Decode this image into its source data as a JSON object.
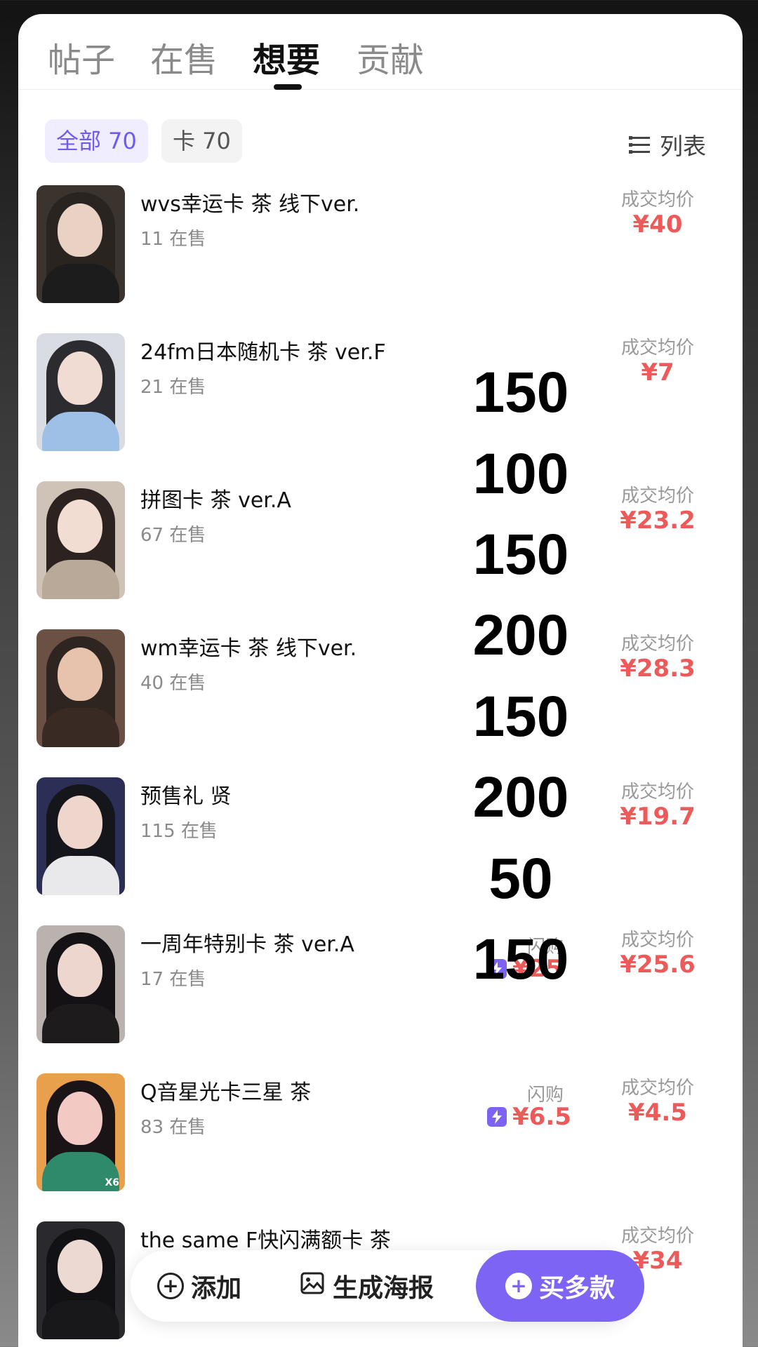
{
  "tabs": [
    {
      "label": "帖子"
    },
    {
      "label": "在售"
    },
    {
      "label": "想要"
    },
    {
      "label": "贡献"
    }
  ],
  "filters": {
    "all": "全部 70",
    "card": "卡 70",
    "view_toggle": "列表"
  },
  "items": [
    {
      "title": "wvs幸运卡 茶 线下ver.",
      "on_sale": "11 在售",
      "avg_label": "成交均价",
      "avg_price": "¥40"
    },
    {
      "title": "24fm日本随机卡 茶 ver.F",
      "on_sale": "21 在售",
      "avg_label": "成交均价",
      "avg_price": "¥7"
    },
    {
      "title": "拼图卡 茶 ver.A",
      "on_sale": "67 在售",
      "avg_label": "成交均价",
      "avg_price": "¥23.2"
    },
    {
      "title": "wm幸运卡 茶 线下ver.",
      "on_sale": "40 在售",
      "avg_label": "成交均价",
      "avg_price": "¥28.3"
    },
    {
      "title": "预售礼 贤",
      "on_sale": "115 在售",
      "avg_label": "成交均价",
      "avg_price": "¥19.7"
    },
    {
      "title": "一周年特别卡 茶 ver.A",
      "on_sale": "17 在售",
      "flash_label": "闪购",
      "flash_price": "¥25",
      "avg_label": "成交均价",
      "avg_price": "¥25.6"
    },
    {
      "title": "Q音星光卡三星 茶",
      "on_sale": "83 在售",
      "flash_label": "闪购",
      "flash_price": "¥6.5",
      "avg_label": "成交均价",
      "avg_price": "¥4.5",
      "thumb_tag": "X6"
    },
    {
      "title": "the same F快闪满额卡 茶",
      "avg_label": "成交均价",
      "avg_price": "¥34"
    }
  ],
  "overlay_numbers": [
    "150",
    "100",
    "150",
    "200",
    "150",
    "200",
    "50",
    "150"
  ],
  "bottom_bar": {
    "add_label": "添加",
    "poster_label": "生成海报",
    "buy_label": "买多款"
  },
  "colors": {
    "accent": "#7d64f3",
    "price": "#ec5a5a",
    "chip_active_bg": "#efedff"
  }
}
